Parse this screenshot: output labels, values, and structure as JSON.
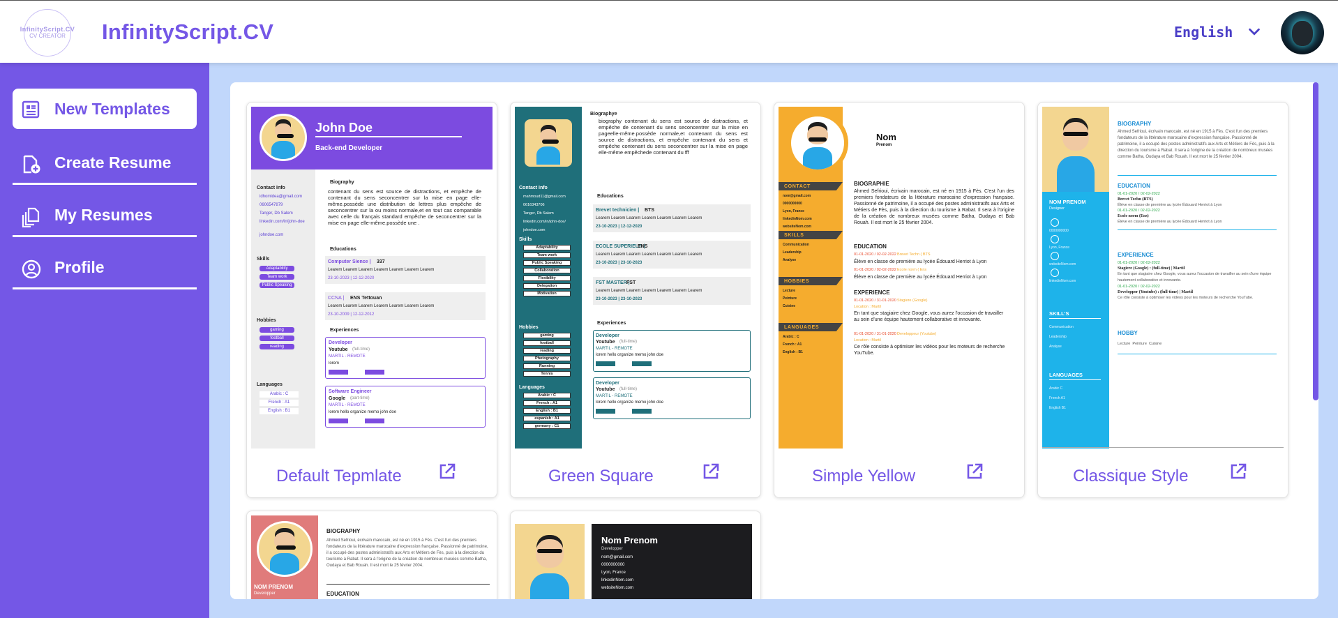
{
  "header": {
    "logo_text_top": "InfinityScript.CV",
    "logo_text_bottom": "CV CREATOR",
    "brand": "InfinityScript.CV",
    "language": "English"
  },
  "sidebar": {
    "items": [
      {
        "label": "New Templates",
        "icon": "document-list-icon",
        "active": true
      },
      {
        "label": "Create Resume",
        "icon": "file-add-icon",
        "active": false
      },
      {
        "label": "My Resumes",
        "icon": "documents-icon",
        "active": false
      },
      {
        "label": "Profile",
        "icon": "user-circle-icon",
        "active": false
      }
    ]
  },
  "templates": [
    {
      "name": "Default Tepmlate",
      "icon": "external-link-icon"
    },
    {
      "name": "Green Square",
      "icon": "external-link-icon"
    },
    {
      "name": "Simple Yellow",
      "icon": "external-link-icon"
    },
    {
      "name": "Classique Style",
      "icon": "external-link-icon"
    }
  ],
  "previews": {
    "default": {
      "name": "John Doe",
      "role": "Back-end Developer",
      "contact_title": "Contact Info",
      "contacts": [
        "idhomidea@gmail.com",
        "0606547879",
        "Tanger, Db Salem",
        "linkedin.com/in/john-doe",
        "johndoe.com"
      ],
      "skills_title": "Skills",
      "skills": [
        "Adaptability",
        "Team work",
        "Public Speaking"
      ],
      "hobbies_title": "Hobbies",
      "hobbies": [
        "gaming",
        "football",
        "reading"
      ],
      "languages_title": "Languages",
      "languages": [
        "Arabic : C",
        "French : A1",
        "English : B1"
      ],
      "bio_title": "Biography",
      "bio": "contenant du sens est source de distractions, et empêche de contenant du sens seconcentrer sur la mise en page elle-même.possède une distribution de lettres plus empêche de seconcentrer sur la ou moins normale,et en tout cas comparable avec celle du français standard empêche de seconcentrer sur la mise en page elle-même.possède une .",
      "educations_title": "Educations",
      "edu": [
        {
          "school": "Computer Sience |",
          "degree": "337",
          "desc": "Learem Learem Learem Learem Learem Learem Learem",
          "dates": "23-10-2023 | 12-12-2020"
        },
        {
          "school": "CCNA |",
          "degree": "ENS Tettouan",
          "desc": "Learem Learem Learem Learem Learem Learem Learem",
          "dates": "23-10-2009 | 12-12-2012"
        }
      ],
      "experiences_title": "Experiences",
      "exp": [
        {
          "title": "Developer",
          "company": "Youtube",
          "type": "(full-time)",
          "place": "MARTIL - REMOTE",
          "desc": "lorem"
        },
        {
          "title": "Software Engineer",
          "company": "Google",
          "type": "(part-time)",
          "place": "MARTIL - REMOTE",
          "desc": "lorem hello organize memo john doe"
        }
      ]
    },
    "green": {
      "bio_title": "Biographye",
      "bio": "biography contenant du sens est source de distractions, et empêche de contenant du sens seconcentrer sur la mise en pageelle-même.possède normale,et contenant du sens est source de distractions, et empêche contenant du sens et empêche contenant du sens seconcentrer sur la mise en page elle-même empêchede contenant du fff",
      "contact_title": "Contact Info",
      "contacts": [
        "mahmoud11@gmail.com",
        "0616343706",
        "Tanger, Db Salem",
        "linkedin.com/in/john-doe/",
        "johndoe.com"
      ],
      "skills_title": "Skills",
      "skills": [
        "Adaptability",
        "Team work",
        "Public Speaking",
        "Collaboration",
        "Flexibility",
        "Delegation",
        "Motivation"
      ],
      "hobbies_title": "Hobbies",
      "hobbies": [
        "gaming",
        "football",
        "reading",
        "Photography",
        "Running",
        "Tennis"
      ],
      "languages_title": "Languages",
      "languages": [
        "Arabic : C",
        "French : A1",
        "English : B1",
        "espanish : A1",
        "germany : C1"
      ],
      "educations_title": "Educations",
      "edu": [
        {
          "school": "Brevet technicien |",
          "degree": "BTS",
          "desc": "Learem Learem Learem Learem Learem Learem Learem",
          "dates": "23-10-2023 | 12-12-2020"
        },
        {
          "school": "ECOLE SUPERIEUR |",
          "degree": "ENS",
          "desc": "Learem Learem Learem Learem Learem Learem Learem",
          "dates": "23-10-2023 | 23-10-2023"
        },
        {
          "school": "FST MASTER |",
          "degree": "FST",
          "desc": "Learem Learem Learem Learem Learem Learem Learem",
          "dates": "23-10-2023 | 23-10-2023"
        }
      ],
      "experiences_title": "Experiences",
      "exp": [
        {
          "title": "Developer",
          "company": "Youtube",
          "type": "(full-time)",
          "place": "MARTIL - REMOTE",
          "desc": "lorem hello organize memo john doe"
        },
        {
          "title": "Developer",
          "company": "Youtube",
          "type": "(full-time)",
          "place": "MARTIL - REMOTE",
          "desc": "lorem hello organize memo john doe"
        }
      ]
    },
    "yellow": {
      "name": "Nom",
      "surname": "Prenom",
      "contact_title": "CONTACT",
      "contacts": [
        "nom@gmail.com",
        "0000000000",
        "Lyon, France",
        "linkedinNom.com",
        "websiteNom.com"
      ],
      "skills_title": "SKILLS",
      "skills": [
        "Communication",
        "Leadership",
        "Analyse"
      ],
      "hobbies_title": "HOBBIES",
      "hobbies": [
        "Lecture",
        "Peinture",
        "Cuisine"
      ],
      "languages_title": "LANGUAGES",
      "languages": [
        "Arabic : C",
        "French : A1",
        "English : B1"
      ],
      "bio_title": "BIOGRAPHIE",
      "bio": "Ahmed Sefrioui, écrivain marocain, est né en 1915 à Fès. C'est l'un des premiers fondateurs de la littérature marocaine d'expression française. Passionné de patrimoine, il a occupé des postes administratifs aux Arts et Métiers de Fès, puis à la direction du tourisme à Rabat. Il sera à l'origine de la création de nombreux musées comme Batha, Oudaya et Bab Rouah. Il est mort le 25 février 2004.",
      "education_title": "EDUCATION",
      "edu": [
        {
          "dates": "01-01-2020 / 02-02-2022",
          "school": "Brevet Techn ( BTS",
          "desc": "Élève en classe de première au lycée Édouard Herriot à Lyon"
        },
        {
          "dates": "01-01-2020 / 02-02-2022",
          "school": "Ecole norm ( Ens",
          "desc": "Élève en classe de première au lycée Édouard Herriot à Lyon"
        }
      ],
      "experience_title": "EXPERIENCE",
      "exp": [
        {
          "dates": "01-01-2020 / 31-01-2020",
          "role": "Stagiere (Google)",
          "place": "Location : Martil",
          "desc": "En tant que stagiaire chez Google, vous aurez l'occasion de travailler au sein d'une équipe hautement collaborative et innovante."
        },
        {
          "dates": "01-01-2020 / 31-01-2020",
          "role": "Developpeur (Youtube)",
          "place": "Location : Martil",
          "desc": "Ce rôle consiste à optimiser les vidéos pour les moteurs de recherche YouTube."
        }
      ]
    },
    "classique": {
      "name": "NOM PRENOM",
      "role": "Designer",
      "contacts": [
        "0000000000",
        "Lyon, France",
        "websiteNom.com",
        "linkedinNom.com"
      ],
      "skills_title": "SKILL'S",
      "skills": [
        "Communication",
        "Leadership",
        "Analyse"
      ],
      "languages_title": "LANGUAGES",
      "languages": [
        "Arabic C",
        "French A1",
        "English B1"
      ],
      "bio_title": "BIOGRAPHY",
      "bio": "Ahmed Sefrioui, écrivain marocain, est né en 1915 à Fès. C'est l'un des premiers fondateurs de la littérature marocaine d'expression française. Passionné de patrimoine, il a occupé des postes administratifs aux Arts et Métiers de Fès, puis à la direction du tourisme à Rabat. Il sera à l'origine de la création de nombreux musées comme Batha, Oudaya et Bab Rouah. Il est mort le 25 février 2004.",
      "education_title": "EDUCATION",
      "edu": [
        {
          "dates": "01-01-2020 / 02-02-2022",
          "school": "Brevet Techn (BTS)",
          "desc": "Élève en classe de première au lycée Édouard Herriot à Lyon"
        },
        {
          "dates": "01-01-2020 / 02-02-2022",
          "school": "Ecole norm (Ens)",
          "desc": "Élève en classe de première au lycée Édouard Herriot à Lyon"
        }
      ],
      "experience_title": "EXPERIENCE",
      "exp": [
        {
          "dates": "01-01-2020 / 02-02-2022",
          "role": "Stagiere (Google) : (full-time) | Martil",
          "desc": "En tant que stagiaire chez Google, vous aurez l'occasion de travailler au sein d'une équipe hautement collaborative et innovante."
        },
        {
          "dates": "01-01-2020 / 02-02-2022",
          "role": "Developper (Youtube) : (full-time) | Martil",
          "desc": "Ce rôle consiste à optimiser les vidéos pour les moteurs de recherche YouTube."
        }
      ],
      "hobby_title": "HOBBY",
      "hobby": "Lecture  Peinture  Cuisine"
    },
    "pink": {
      "bio_title": "BIOGRAPHY",
      "bio": "Ahmed Sefrioui, écrivain marocain, est né en 1915 à Fès. C'est l'un des premiers fondateurs de la littérature marocaine d'expression française. Passionné de patrimoine, il a occupé des postes administratifs aux Arts et Métiers de Fès, puis à la direction du tourisme à Rabat. Il sera à l'origine de la création de nombreux musées comme Batha, Oudaya et Bab Rouah. Il est mort le 25 février 2004.",
      "name": "NOM PRENOM",
      "role": "Developper",
      "education_title": "EDUCATION"
    },
    "dark": {
      "name": "Nom Prenom",
      "role": "Developper",
      "contacts": [
        "nom@gmail.com",
        "0000000000",
        "Lyon, France",
        "linkedinNom.com",
        "websiteNom.com"
      ]
    }
  },
  "colors": {
    "accent": "#7457e6",
    "content_bg": "#c1d7fb",
    "teal": "#1f6f7a",
    "yellow": "#f5ac2e",
    "blue": "#1eb3ea",
    "pink": "#e07b7b"
  }
}
